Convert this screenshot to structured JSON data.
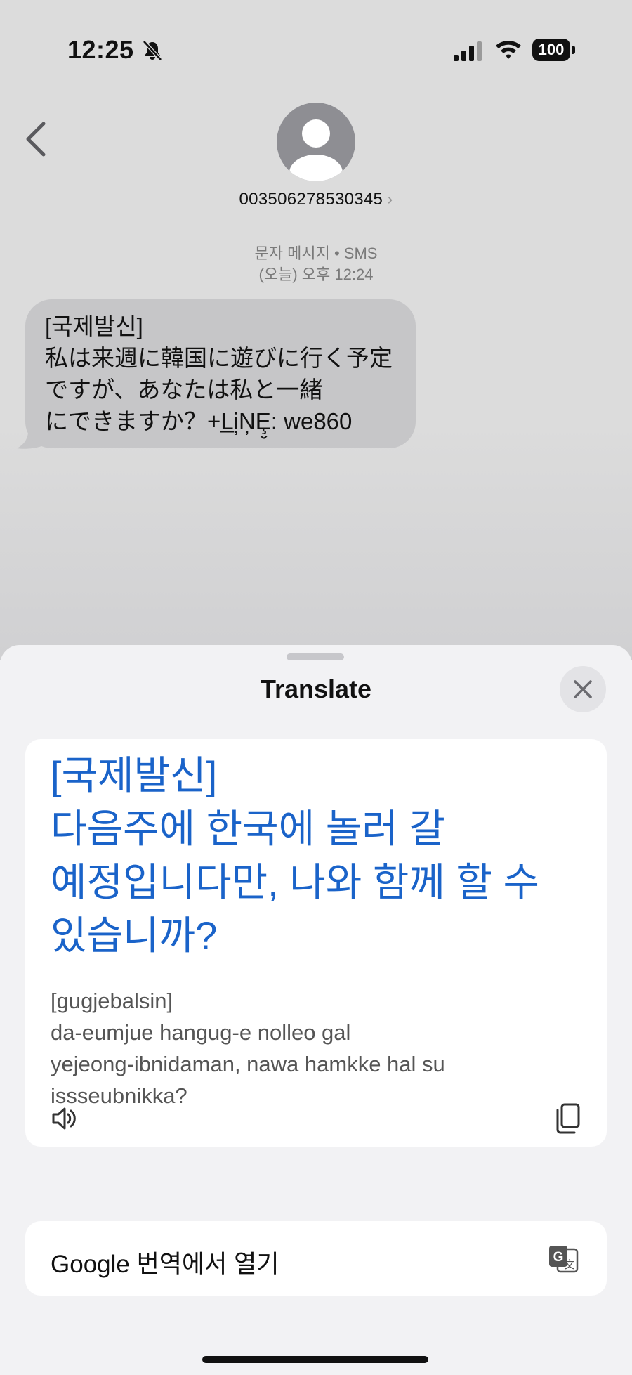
{
  "status_bar": {
    "time": "12:25",
    "battery": "100",
    "icons": [
      "bell-slash-icon",
      "signal-icon",
      "wifi-icon",
      "battery-icon"
    ]
  },
  "header": {
    "back_icon": "chevron-left-icon",
    "contact": "003506278530345",
    "contact_chevron": "›"
  },
  "conversation": {
    "meta_line1": "문자 메시지 • SMS",
    "meta_line2": "(오늘) 오후 12:24",
    "message_lines": [
      "[국제발신]",
      "私は来週に韓国に遊びに行く予定",
      "ですが、あなたは私と一緒",
      "にできますか？+L̲i̦N̦Ȩ̬: we860"
    ]
  },
  "translate_sheet": {
    "title": "Translate",
    "close_icon": "xmark-icon",
    "translated_lines": [
      "[국제발신]",
      "다음주에 한국에 놀러 갈",
      "예정입니다만, 나와 함께 할 수",
      "있습니까?"
    ],
    "romanized_lines": [
      "[gugjebalsin]",
      "da-eumjue hangug-e nolleo gal",
      "yejeong-ibnidaman, nawa hamkke hal su",
      "issseubnikka?"
    ],
    "speaker_icon": "speaker-wave-icon",
    "copy_icon": "copy-icon",
    "google_label": "Google 번역에서 열기",
    "google_icon": "google-translate-icon"
  },
  "colors": {
    "translated_text": "#1a63c9",
    "bubble": "#c6c6c8"
  }
}
